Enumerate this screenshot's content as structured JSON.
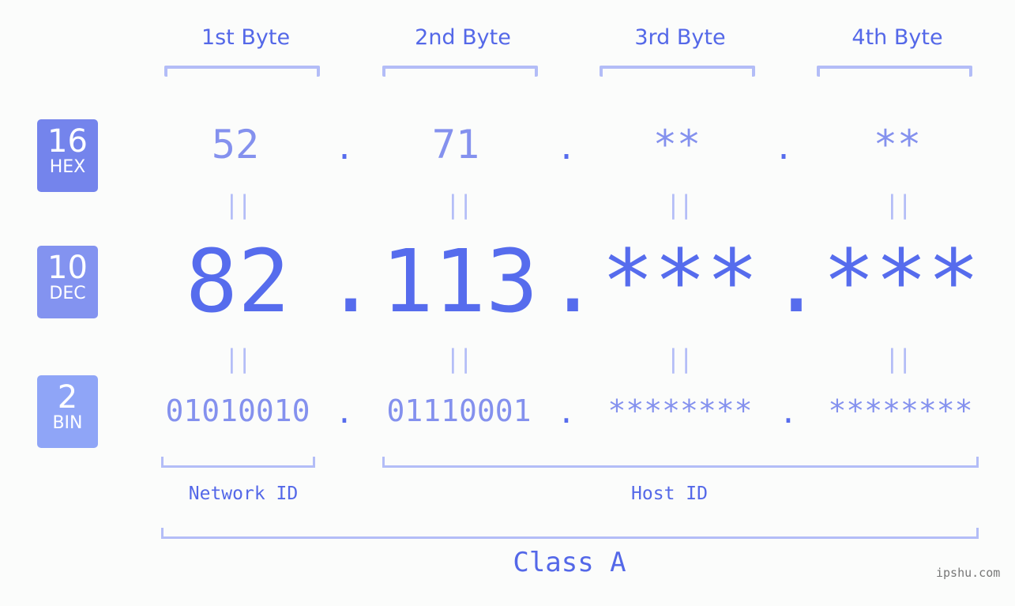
{
  "header": {
    "bytes": [
      "1st Byte",
      "2nd Byte",
      "3rd Byte",
      "4th Byte"
    ]
  },
  "badges": {
    "hex": {
      "num": "16",
      "label": "HEX",
      "color": "#7484ec"
    },
    "dec": {
      "num": "10",
      "label": "DEC",
      "color": "#8393f0"
    },
    "bin": {
      "num": "2",
      "label": "BIN",
      "color": "#8fa5f7"
    }
  },
  "rows": {
    "hex": [
      "52",
      "71",
      "**",
      "**"
    ],
    "dec": [
      "82",
      "113",
      "***",
      "***"
    ],
    "bin": [
      "01010010",
      "01110001",
      "********",
      "********"
    ],
    "separator": ".",
    "equals": "||"
  },
  "groups": {
    "network_id": "Network ID",
    "host_id": "Host ID",
    "class": "Class A"
  },
  "colors": {
    "accent": "#566ced",
    "light": "#8491ee",
    "bracket": "#b3bdf7",
    "background": "#fbfcfb"
  },
  "watermark": "ipshu.com"
}
